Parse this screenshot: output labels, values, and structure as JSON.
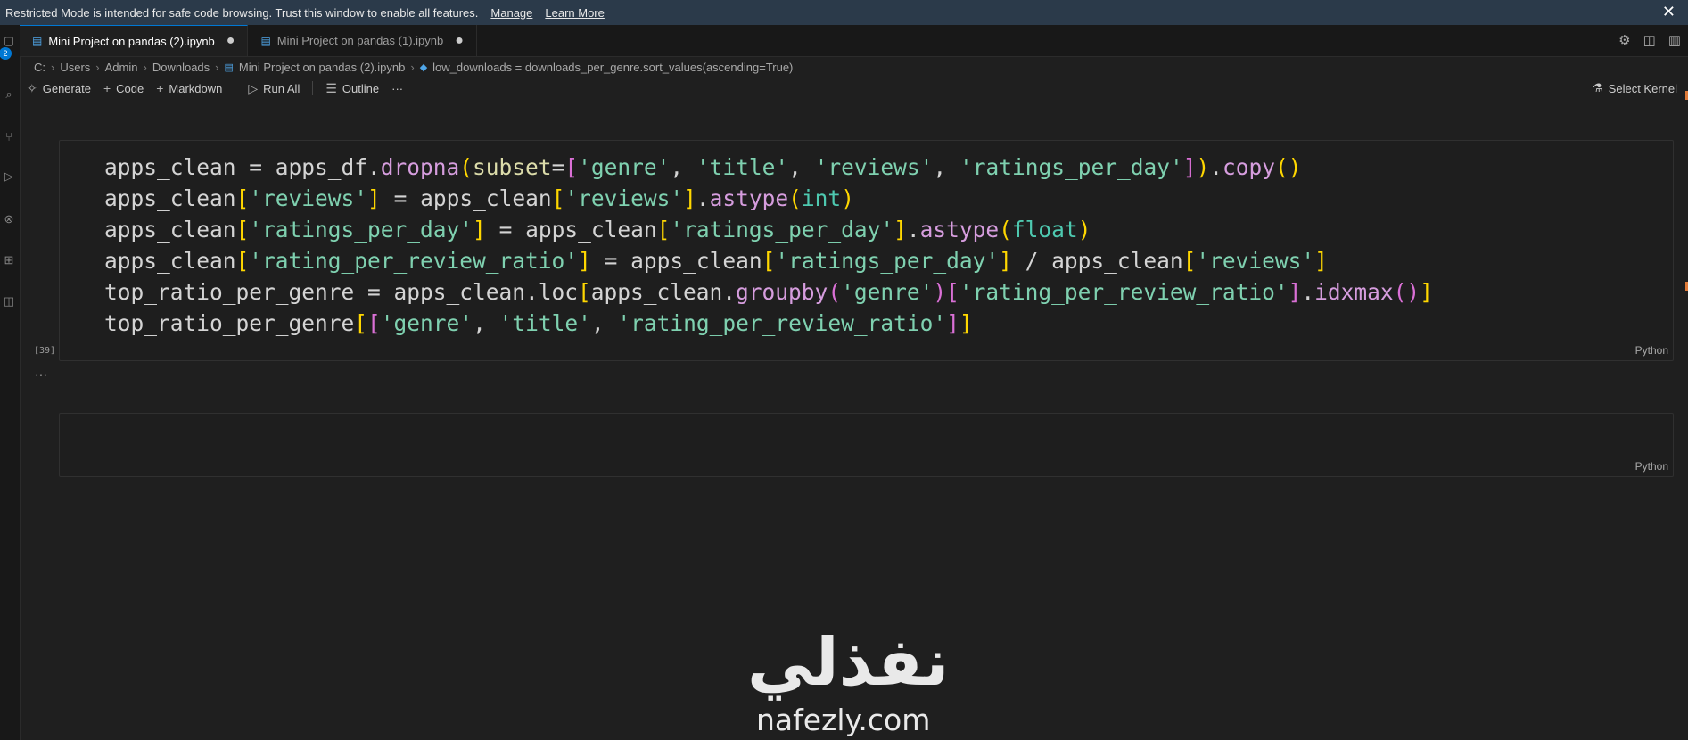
{
  "banner": {
    "message": "Restricted Mode is intended for safe code browsing. Trust this window to enable all features.",
    "manage": "Manage",
    "learn_more": "Learn More",
    "close": "✕"
  },
  "activity": {
    "badge": "2"
  },
  "tabs": [
    {
      "label": "Mini Project on pandas (2).ipynb",
      "active": true,
      "modified": true
    },
    {
      "label": "Mini Project on pandas (1).ipynb",
      "active": false,
      "modified": true
    }
  ],
  "breadcrumb": [
    "C:",
    "Users",
    "Admin",
    "Downloads",
    "Mini Project on pandas (2).ipynb",
    "low_downloads = downloads_per_genre.sort_values(ascending=True)"
  ],
  "toolbar": {
    "generate": "Generate",
    "code": "Code",
    "markdown": "Markdown",
    "run_all": "Run All",
    "outline": "Outline",
    "more": "···",
    "select_kernel": "Select Kernel"
  },
  "cells": [
    {
      "lines": [
        "apps_clean = apps_df.dropna(subset=['genre', 'title', 'reviews', 'ratings_per_day']).copy()",
        "apps_clean['reviews'] = apps_clean['reviews'].astype(int)",
        "apps_clean['ratings_per_day'] = apps_clean['ratings_per_day'].astype(float)",
        "apps_clean['rating_per_review_ratio'] = apps_clean['ratings_per_day'] / apps_clean['reviews']",
        "top_ratio_per_genre = apps_clean.loc[apps_clean.groupby('genre')['rating_per_review_ratio'].idxmax()]",
        "top_ratio_per_genre[['genre', 'title', 'rating_per_review_ratio']]"
      ],
      "language": "Python",
      "exec_count": "[39]",
      "output_more": "···"
    },
    {
      "lines": [],
      "language": "Python"
    }
  ],
  "watermark": {
    "arabic": "نفذلي",
    "latin": "nafezly.com"
  }
}
